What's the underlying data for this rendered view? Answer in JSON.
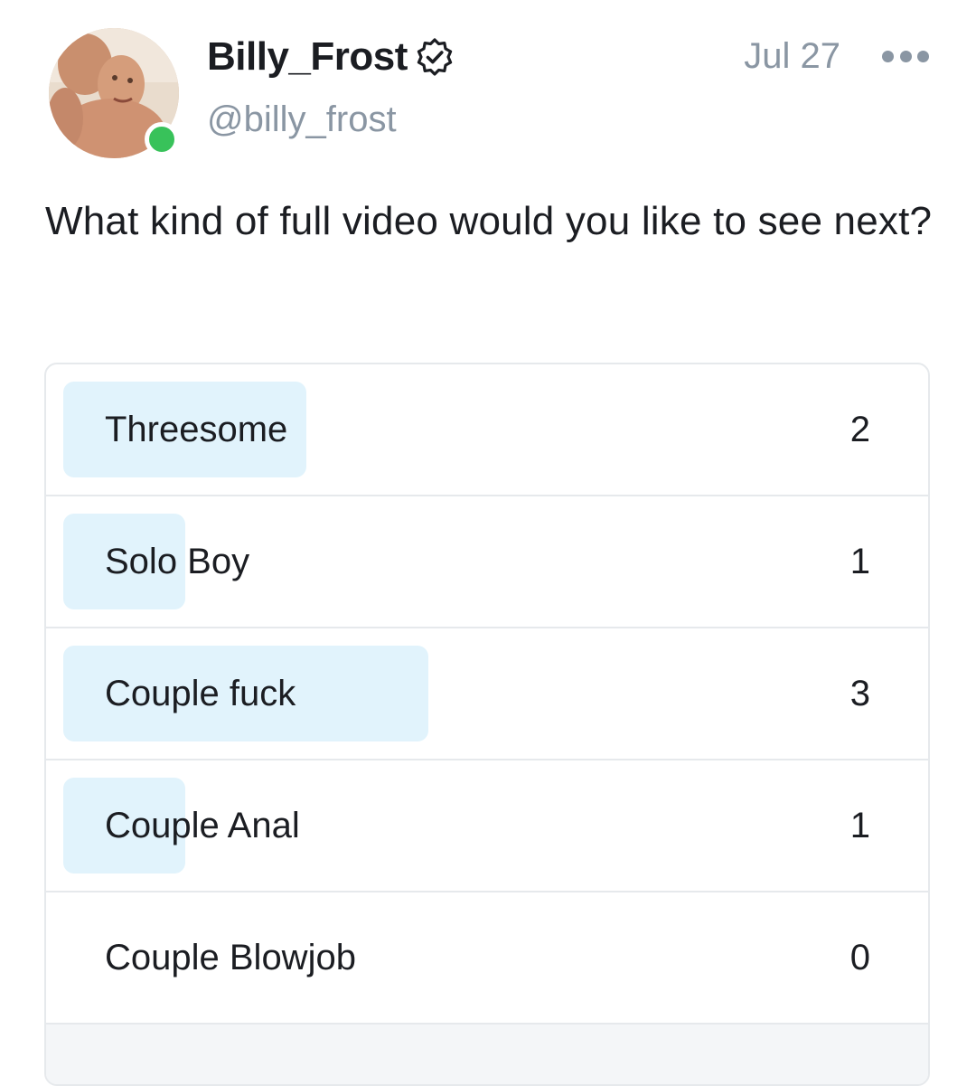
{
  "author": {
    "display_name": "Billy_Frost",
    "handle": "@billy_frost",
    "verified": true,
    "online": true,
    "avatar_icon": "user-avatar-photo",
    "verified_icon": "verified-badge-icon"
  },
  "post": {
    "date": "Jul 27",
    "more_icon": "more-dots-icon",
    "text": "What kind of full video would you like to see next?"
  },
  "poll": {
    "options": [
      {
        "label": "Threesome",
        "count": "2",
        "share": 0.286
      },
      {
        "label": "Solo Boy",
        "count": "1",
        "share": 0.143
      },
      {
        "label": "Couple fuck",
        "count": "3",
        "share": 0.429
      },
      {
        "label": "Couple Anal",
        "count": "1",
        "share": 0.143
      },
      {
        "label": "Couple Blowjob",
        "count": "0",
        "share": 0
      }
    ]
  },
  "colors": {
    "bar": "#e1f3fc",
    "muted_text": "#8a96a3",
    "online": "#38c25a",
    "border": "#e6e9ec"
  }
}
